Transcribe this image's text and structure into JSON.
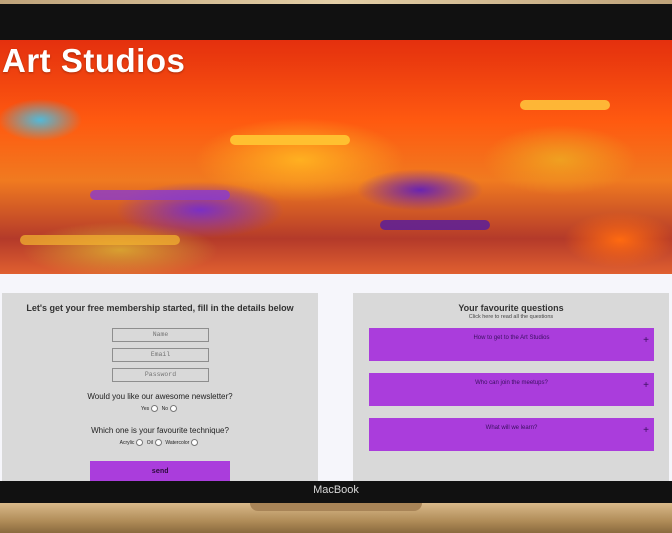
{
  "hero": {
    "title": "Art Studios"
  },
  "signup": {
    "title": "Let's get your free membership started, fill in the details below",
    "name_placeholder": "Name",
    "email_placeholder": "Email",
    "password_placeholder": "Password",
    "newsletter_question": "Would you like our awesome newsletter?",
    "newsletter_options": [
      "Yes",
      "No"
    ],
    "technique_question": "Which one is your favourite technique?",
    "technique_options": [
      "Acrylic",
      "Oil",
      "Watercolor"
    ],
    "send_label": "send"
  },
  "faq": {
    "title": "Your favourite questions",
    "subtitle": "Click here to read all the questions",
    "items": [
      {
        "label": "How to get to the Art Studios"
      },
      {
        "label": "Who can join the meetups?"
      },
      {
        "label": "What will we learn?"
      }
    ],
    "expand_symbol": "+"
  },
  "device": {
    "brand": "MacBook"
  },
  "colors": {
    "accent": "#aa3ddc",
    "panel": "#d9d9d9"
  }
}
